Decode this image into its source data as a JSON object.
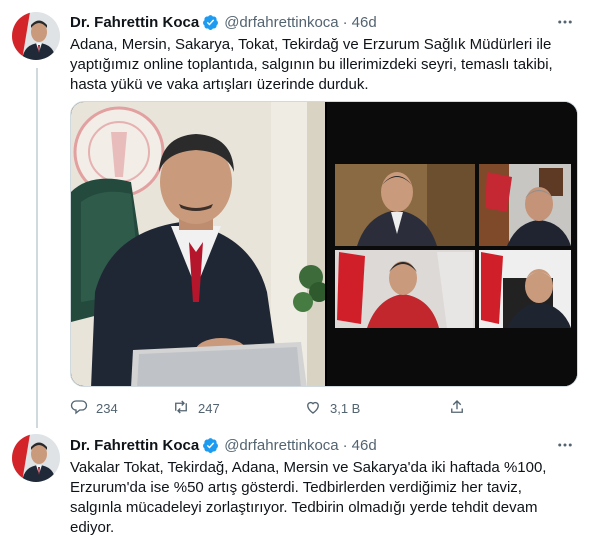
{
  "tweets": [
    {
      "author_name": "Dr. Fahrettin Koca",
      "handle": "@drfahrettinkoca",
      "separator": "·",
      "time": "46d",
      "text": "Adana, Mersin, Sakarya, Tokat, Tekirdağ ve Erzurum Sağlık Müdürleri ile yaptığımız online toplantıda, salgının bu illerimizdeki seyri, temaslı takibi, hasta yükü ve vaka artışları üzerinde durduk.",
      "actions": {
        "replies": "234",
        "retweets": "247",
        "likes": "3,1 B"
      }
    },
    {
      "author_name": "Dr. Fahrettin Koca",
      "handle": "@drfahrettinkoca",
      "separator": "·",
      "time": "46d",
      "text": "Vakalar Tokat, Tekirdağ, Adana, Mersin ve Sakarya'da iki haftada %100, Erzurum'da ise %50 artış gösterdi. Tedbirlerden verdiğimiz her taviz, salgınla mücadeleyi zorlaştırıyor. Tedbirin olmadığı yerde tehdit devam ediyor."
    }
  ],
  "colors": {
    "verified": "#1d9bf0",
    "secondary_text": "#536471",
    "primary_text": "#0f1419"
  },
  "icons": [
    "more-icon",
    "verified-icon",
    "reply-icon",
    "retweet-icon",
    "like-icon",
    "share-icon"
  ]
}
